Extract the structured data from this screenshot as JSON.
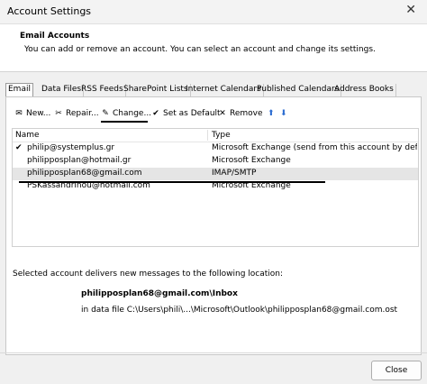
{
  "window": {
    "title": "Account Settings",
    "close_glyph": "✕"
  },
  "header": {
    "heading": "Email Accounts",
    "description": "You can add or remove an account. You can select an account and change its settings."
  },
  "tabs": [
    {
      "label": "Email",
      "active": true
    },
    {
      "label": "Data Files"
    },
    {
      "label": "RSS Feeds"
    },
    {
      "label": "SharePoint Lists"
    },
    {
      "label": "Internet Calendars"
    },
    {
      "label": "Published Calendars"
    },
    {
      "label": "Address Books"
    }
  ],
  "toolbar": {
    "new_label": "New...",
    "repair_label": "Repair...",
    "change_label": "Change...",
    "default_label": "Set as Default",
    "remove_label": "Remove",
    "up_glyph": "⬆",
    "down_glyph": "⬇"
  },
  "accounts": {
    "columns": {
      "name": "Name",
      "type": "Type"
    },
    "rows": [
      {
        "name": "philip@systemplus.gr",
        "type": "Microsoft Exchange (send from this account by defa...",
        "default": true
      },
      {
        "name": "philipposplan@hotmail.gr",
        "type": "Microsoft Exchange"
      },
      {
        "name": "philipposplan68@gmail.com",
        "type": "IMAP/SMTP",
        "selected": true
      },
      {
        "name": "PSKassandrinou@hotmail.com",
        "type": "Microsoft Exchange"
      }
    ]
  },
  "delivery": {
    "label": "Selected account delivers new messages to the following location:",
    "folder": "philipposplan68@gmail.com\\Inbox",
    "data_file": "in data file C:\\Users\\phili\\...\\Microsoft\\Outlook\\philipposplan68@gmail.com.ost"
  },
  "footer": {
    "close_label": "Close"
  },
  "colors": {
    "selection": "#e5e5e5",
    "arrow": "#2b6cd1"
  }
}
